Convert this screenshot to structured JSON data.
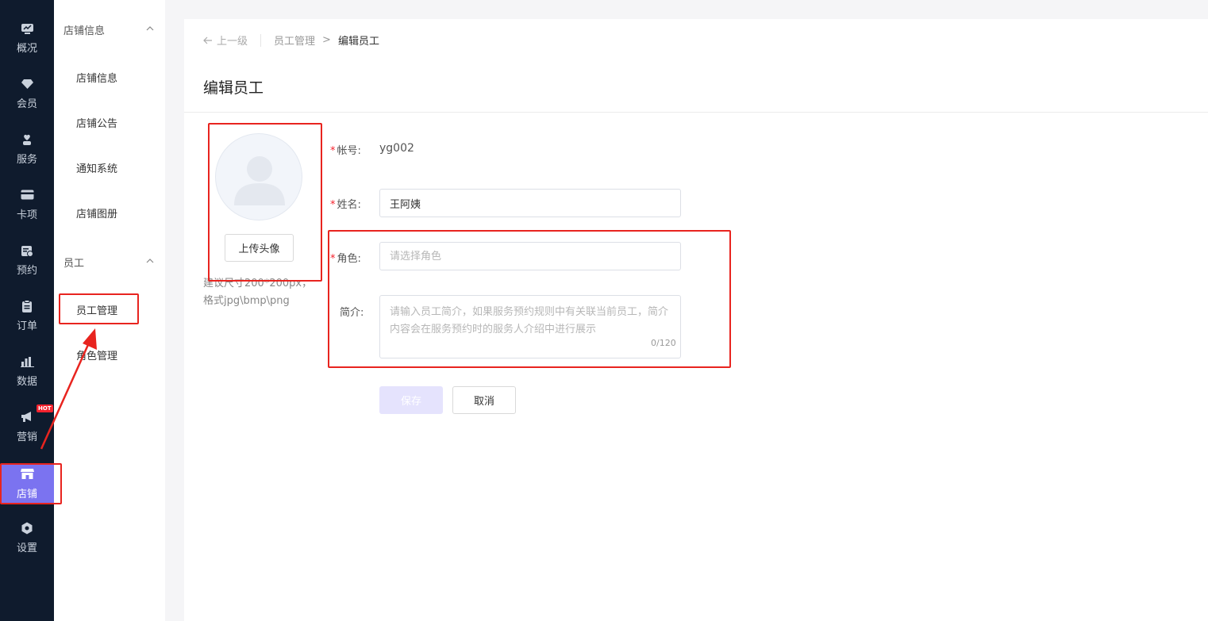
{
  "rail": {
    "items": [
      {
        "label": "概况",
        "icon": "monitor-icon"
      },
      {
        "label": "会员",
        "icon": "diamond-icon"
      },
      {
        "label": "服务",
        "icon": "hand-heart-icon"
      },
      {
        "label": "卡项",
        "icon": "card-icon"
      },
      {
        "label": "预约",
        "icon": "calendar-check-icon"
      },
      {
        "label": "订单",
        "icon": "clipboard-icon"
      },
      {
        "label": "数据",
        "icon": "bar-chart-icon"
      },
      {
        "label": "营销",
        "icon": "megaphone-icon",
        "badge": "HOT"
      },
      {
        "label": "店铺",
        "icon": "store-icon",
        "active": true
      },
      {
        "label": "设置",
        "icon": "gear-icon"
      }
    ]
  },
  "subnav": {
    "groups": [
      {
        "title": "店铺信息",
        "items": [
          "店铺信息",
          "店铺公告",
          "通知系统",
          "店铺图册"
        ]
      },
      {
        "title": "员工",
        "items": [
          "员工管理",
          "角色管理"
        ]
      }
    ],
    "selected": "员工管理"
  },
  "breadcrumb": {
    "back": "上一级",
    "parent": "员工管理",
    "separator": ">",
    "current": "编辑员工"
  },
  "page": {
    "title": "编辑员工"
  },
  "avatar": {
    "upload_label": "上传头像",
    "hint_line1": "建议尺寸200*200px，",
    "hint_line2": "格式jpg\\bmp\\png"
  },
  "form": {
    "account": {
      "label": "帐号:",
      "value": "yg002",
      "required": true
    },
    "name": {
      "label": "姓名:",
      "value": "王阿姨",
      "required": true
    },
    "role": {
      "label": "角色:",
      "placeholder": "请选择角色",
      "required": true
    },
    "intro": {
      "label": "简介:",
      "placeholder": "请输入员工简介，如果服务预约规则中有关联当前员工，简介内容会在服务预约时的服务人介绍中进行展示",
      "counter": "0/120"
    },
    "save_label": "保存",
    "cancel_label": "取消"
  },
  "colors": {
    "rail_bg": "#0f1b2d",
    "accent": "#7b73f0",
    "annotation": "#e8241f",
    "required": "#f5222d"
  }
}
